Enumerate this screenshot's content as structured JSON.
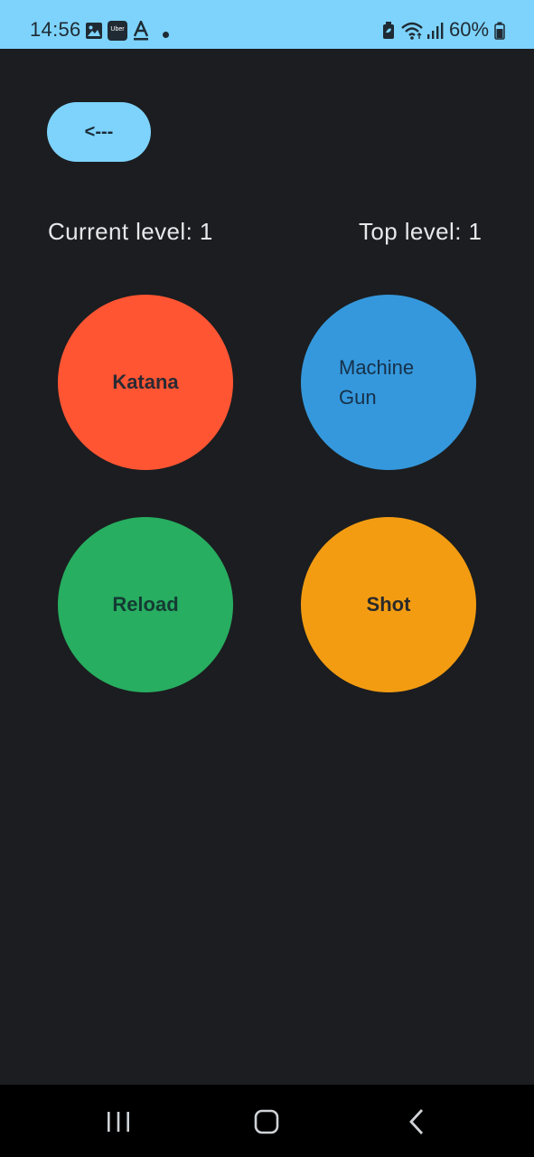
{
  "status_bar": {
    "time": "14:56",
    "battery_text": "60%",
    "background": "#7dd3fc",
    "icons": [
      "image-icon",
      "uber-icon",
      "font-a-icon",
      "dot-icon",
      "battery-saver-icon",
      "wifi-icon",
      "signal-icon",
      "battery-icon"
    ],
    "uber_text": "Uber"
  },
  "back_button": {
    "label": "<---"
  },
  "levels": {
    "current": "Current level: 1",
    "top": "Top level: 1"
  },
  "weapons": [
    {
      "label": "Katana",
      "color": "#ff5533"
    },
    {
      "label": "Machine Gun",
      "color": "#3598dc"
    },
    {
      "label": "Reload",
      "color": "#27ae60"
    },
    {
      "label": "Shot",
      "color": "#f39c12"
    }
  ],
  "nav_bar": {
    "items": [
      "recent-apps-icon",
      "home-icon",
      "back-icon"
    ]
  }
}
